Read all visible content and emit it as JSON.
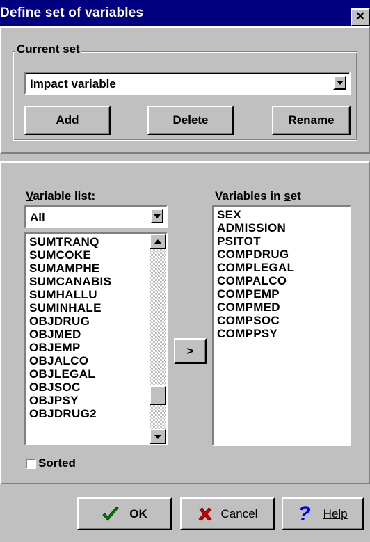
{
  "window": {
    "title": "Define set of variables",
    "close_glyph": "✕"
  },
  "current_set": {
    "group_label": "Current set",
    "selected": "Impact variable",
    "add_label": "Add",
    "delete_label": "Delete",
    "rename_label": "Rename"
  },
  "variable_list": {
    "label": "Variable list:",
    "filter": "All",
    "items": [
      "SUMTRANQ",
      "SUMCOKE",
      "SUMAMPHE",
      "SUMCANABIS",
      "SUMHALLU",
      "SUMINHALE",
      "OBJDRUG",
      "OBJMED",
      "OBJEMP",
      "OBJALCO",
      "OBJLEGAL",
      "OBJSOC",
      "OBJPSY",
      "OBJDRUG2"
    ],
    "scroll_position": 0.85,
    "sorted_label": "Sorted",
    "sorted_checked": false
  },
  "move_button_label": ">",
  "variables_in_set": {
    "label": "Variables in set",
    "items": [
      "SEX",
      "ADMISSION",
      "PSITOT",
      "COMPDRUG",
      "COMPLEGAL",
      "COMPALCO",
      "COMPEMP",
      "COMPMED",
      "COMPSOC",
      "COMPPSY"
    ]
  },
  "footer": {
    "ok_label": "OK",
    "cancel_label": "Cancel",
    "help_label": "Help",
    "ok_icon": "checkmark-icon",
    "cancel_icon": "x-icon",
    "help_icon": "question-icon",
    "colors": {
      "ok": "#008000",
      "cancel": "#cc0000",
      "help": "#0000ff"
    }
  }
}
